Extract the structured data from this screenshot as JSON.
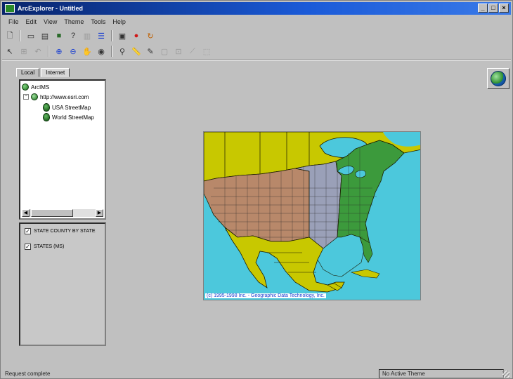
{
  "window": {
    "title": "ArcExplorer - Untitled"
  },
  "menu": [
    "File",
    "Edit",
    "View",
    "Theme",
    "Tools",
    "Help"
  ],
  "toolbar1": [
    "new-icon",
    "open-icon",
    "save-icon",
    "print-icon",
    "help-icon",
    "theme-icon",
    "legend-icon",
    "map-icon",
    "stop-icon",
    "refresh-icon"
  ],
  "toolbar2": [
    "select-icon",
    "zoom-in-icon",
    "zoom-out-icon",
    "zoom-extent-icon",
    "zoom-previous-icon",
    "pan-icon",
    "identify-icon",
    "find-icon",
    "measure-icon",
    "query-icon",
    "buffer-icon",
    "label-icon"
  ],
  "tabs": [
    "Local",
    "Internet"
  ],
  "tree": {
    "root": "ArcIMS",
    "server": "http://www.esri.com",
    "services": [
      "USA StreetMap",
      "World StreetMap"
    ]
  },
  "layers": [
    {
      "label": "STATE COUNTY BY STATE",
      "checked": true
    },
    {
      "label": "STATES (MS)",
      "checked": true
    }
  ],
  "map": {
    "copyright": "(c) 1995-1998 Inc. - Geographic Data Technology, Inc."
  },
  "status": {
    "message": "Request complete",
    "pane": "No Active Theme"
  },
  "colors": {
    "ocean": "#4cc8dc",
    "land_other": "#c8c800",
    "usa_west": "#b8886a",
    "usa_east": "#3c9a3c",
    "titlebar": "#08246b"
  }
}
